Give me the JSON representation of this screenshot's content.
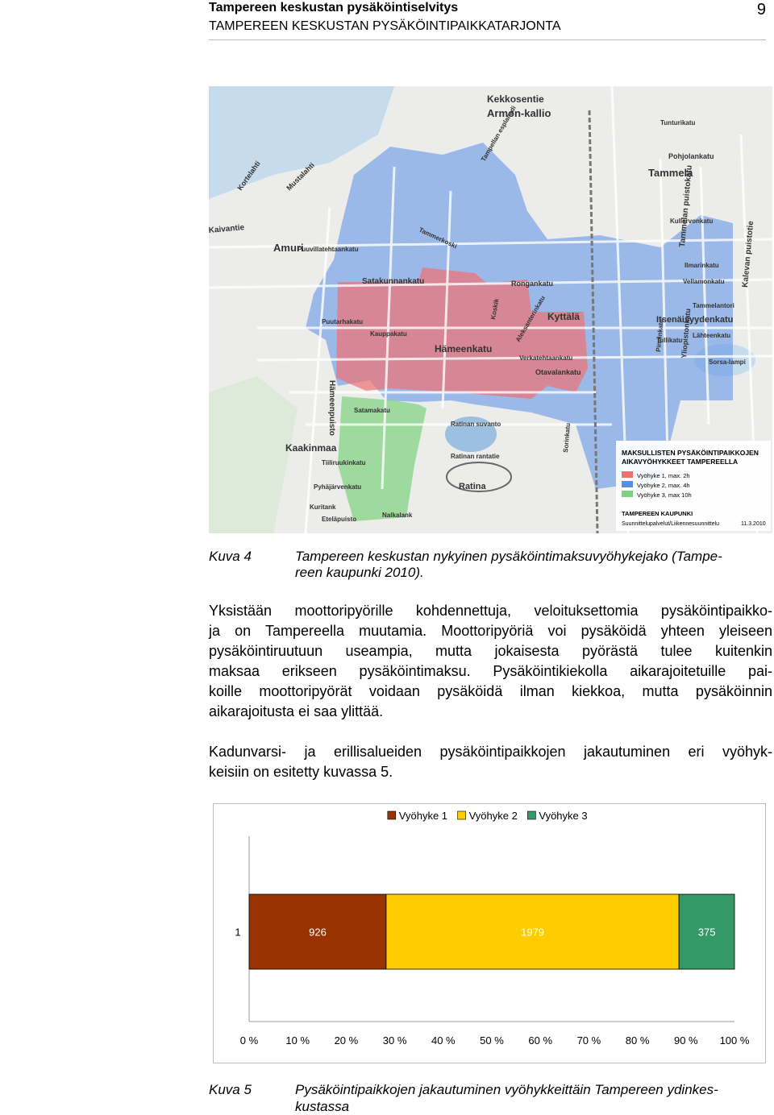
{
  "header": {
    "title": "Tampereen keskustan pysäköintiselvitys",
    "subtitle": "TAMPEREEN KESKUSTAN PYSÄKÖINTIPAIKKATARJONTA",
    "page_number": "9"
  },
  "map": {
    "streets": [
      "Kekkosentie",
      "Armon-kallio",
      "Tunturikatu",
      "Pohjolankatu",
      "Tammela",
      "Tammelan puistokatu",
      "Kalevan puistotie",
      "Amuri",
      "Puuvillatehtaankatu",
      "Satakunnankatu",
      "Rongankatu",
      "Itsenäisyydenkatu",
      "Hämeenkatu",
      "Kyttälä",
      "Otavalankatu",
      "Ratinan suvanto",
      "Ratina",
      "Kaakinmaa",
      "Tampellan esplanadi",
      "Tammerkoski",
      "Kullervonkatu",
      "Ilmarinkatu",
      "Vellamonkatu",
      "Tammelantori",
      "Lähteenkatu",
      "Sorsa-lampi",
      "Yliopistonkatu",
      "Verkatehtaankatu",
      "Aleksanterinkatu",
      "Puutarhakatu",
      "Kauppakatu",
      "Hämeenpuisto",
      "Satamakatu",
      "Tiiliruukinkatu",
      "Pyhäjärvenkatu",
      "Nalkalank",
      "Kuritank",
      "Eteläpuisto",
      "Ratinan rantatie",
      "Sorinkatu",
      "Pinninkatu",
      "Tullikatu",
      "Koskik",
      "Kortelahti",
      "Mustalahti",
      "Kaivantie"
    ],
    "legend": {
      "title_line1": "MAKSULLISTEN PYSÄKÖINTIPAIKKOJEN",
      "title_line2": "AIKAVYÖHYKKEET TAMPEREELLA",
      "items": [
        {
          "label": "Vyöhyke 1, max. 2h",
          "color": "#f07070"
        },
        {
          "label": "Vyöhyke 2, max. 4h",
          "color": "#5a8fe6"
        },
        {
          "label": "Vyöhyke 3, max 10h",
          "color": "#7dd27d"
        }
      ],
      "org": "TAMPEREEN KAUPUNKI",
      "dept": "Suunnittelupalvelut/Liikennesuunnittelu",
      "date": "11.3.2010"
    }
  },
  "figure4": {
    "label": "Kuva 4",
    "caption_line1": "Tampereen keskustan nykyinen pysäköintimaksuvyöhykejako (Tampe-",
    "caption_line2": "reen kaupunki 2010)."
  },
  "body": {
    "p1_lines": [
      "Yksistään moottoripyörille kohdennettuja, veloituksettomia pysäköintipaikko-",
      "ja on Tampereella muutamia. Moottoripyöriä voi pysäköidä yhteen yleiseen",
      "pysäköintiruutuun useampia, mutta jokaisesta pyörästä tulee kuitenkin",
      "maksaa erikseen pysäköintimaksu. Pysäköintikiekolla aikarajoitetuille pai-",
      "koille moottoripyörät voidaan pysäköidä ilman kiekkoa, mutta pysäköinnin",
      "aikarajoitusta ei saa ylittää."
    ],
    "p2_lines": [
      "Kadunvarsi- ja erillisalueiden pysäköintipaikkojen jakautuminen eri vyöhyk-",
      "keisiin on esitetty kuvassa 5."
    ]
  },
  "chart_data": {
    "type": "bar",
    "orientation": "horizontal",
    "stacking": "percent",
    "categories": [
      "1"
    ],
    "series": [
      {
        "name": "Vyöhyke 1",
        "values": [
          926
        ],
        "color": "#993300"
      },
      {
        "name": "Vyöhyke 2",
        "values": [
          1979
        ],
        "color": "#ffcc00"
      },
      {
        "name": "Vyöhyke 3",
        "values": [
          375
        ],
        "color": "#339966"
      }
    ],
    "x_ticks": [
      "0 %",
      "10 %",
      "20 %",
      "30 %",
      "40 %",
      "50 %",
      "60 %",
      "70 %",
      "80 %",
      "90 %",
      "100 %"
    ],
    "xlim": [
      0,
      100
    ],
    "legend_position": "top",
    "grid": false
  },
  "figure5": {
    "label": "Kuva 5",
    "caption_line1": "Pysäköintipaikkojen jakautuminen vyöhykkeittäin Tampereen ydinkes-",
    "caption_line2": "kustassa"
  }
}
